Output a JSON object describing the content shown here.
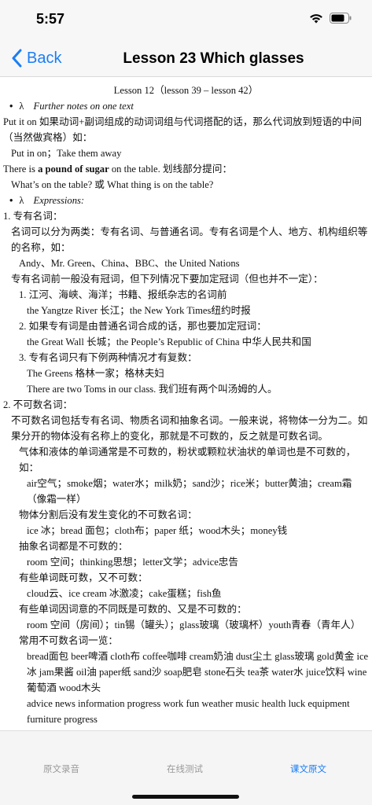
{
  "status_bar": {
    "time": "5:57"
  },
  "nav": {
    "back_label": "Back",
    "title": "Lesson 23 Which glasses"
  },
  "content": {
    "heading": "Lesson 12（lesson 39 – lesson 42）",
    "bullet1": {
      "marker": "λ",
      "title": "Further notes on one text"
    },
    "p1": "Put it on 如果动词+副词组成的动词词组与代词搭配的话，那么代词放到短语的中间（当然做宾格）如：",
    "p2": "Put in on；Take them away",
    "p3_pre": "There is ",
    "p3_bold": "a pound of sugar",
    "p3_post": " on the table. 划线部分提问：",
    "p4": "What’s on the table? 或 What thing is on the table?",
    "bullet2": {
      "marker": "λ",
      "title": "Expressions:"
    },
    "s1_title": "1. 专有名词：",
    "s1_p1": "名词可以分为两类：专有名词、与普通名词。专有名词是个人、地方、机构组织等的名称，如：",
    "s1_p2": "Andy、Mr. Green、China、BBC、the United Nations",
    "s1_p3": "专有名词前一般没有冠词，但下列情况下要加定冠词（但也并不一定）：",
    "s1_i1": "1. 江河、海峡、海洋；书籍、报纸杂志的名词前",
    "s1_i1_ex": "the Yangtze River 长江；the New York Times纽约时报",
    "s1_i2": "2. 如果专有词是由普通名词合成的话，那也要加定冠词：",
    "s1_i2_ex": "the Great Wall 长城；the People’s Republic of China 中华人民共和国",
    "s1_i3": "3. 专有名词只有下例两种情况才有复数：",
    "s1_i3_ex1": "The Greens 格林一家；格林夫妇",
    "s1_i3_ex2": "There are two Toms in our class. 我们班有两个叫汤姆的人。",
    "s2_title": "2. 不可数名词：",
    "s2_p1": "不可数名词包括专有名词、物质名词和抽象名词。一般来说，将物体一分为二。如果分开的物体没有名称上的变化，那就是不可数的，反之就是可数名词。",
    "s2_p2": "气体和液体的单词通常是不可数的，粉状或颗粒状油状的单词也是不可数的，如：",
    "s2_p2_ex": "air空气；smoke烟；water水；milk奶；sand沙；rice米；butter黄油；cream霜（像霜一样）",
    "s2_p3": "物体分割后没有发生变化的不可数名词：",
    "s2_p3_ex": "ice 冰；bread 面包；cloth布；paper 纸；wood木头；money钱",
    "s2_p4": "抽象名词都是不可数的：",
    "s2_p4_ex": "room 空间；thinking思想；letter文学；advice忠告",
    "s2_p5": "有些单词既可数，又不可数：",
    "s2_p5_ex": "cloud云、ice cream 冰激凌；cake蛋糕；fish鱼",
    "s2_p6": "有些单词因词意的不同既是可数的、又是不可数的：",
    "s2_p6_ex": "room 空间（房间）；tin锡（罐头）；glass玻璃（玻璃杯）youth青春（青年人）",
    "s2_p7": "常用不可数名词一览：",
    "s2_p7_ex1": "bread面包 beer啤酒 cloth布 coffee咖啡 cream奶油 dust尘土 glass玻璃 gold黄金 ice冰 jam果酱 oil油 paper纸 sand沙 soap肥皂 stone石头 tea茶 water水 juice饮料 wine葡萄酒 wood木头",
    "s2_p7_ex2": "advice news information progress work fun weather music health luck equipment furniture progress"
  },
  "tabs": [
    {
      "label": "原文录音",
      "active": false
    },
    {
      "label": "在线测试",
      "active": false
    },
    {
      "label": "课文原文",
      "active": true
    }
  ],
  "colors": {
    "accent": "#1a7ef5",
    "inactive_tab": "#9a9a9a",
    "bar_bg": "#f7f7f7"
  },
  "icons": {
    "back": "chevron-left-icon",
    "wifi": "wifi-icon",
    "battery": "battery-icon"
  }
}
